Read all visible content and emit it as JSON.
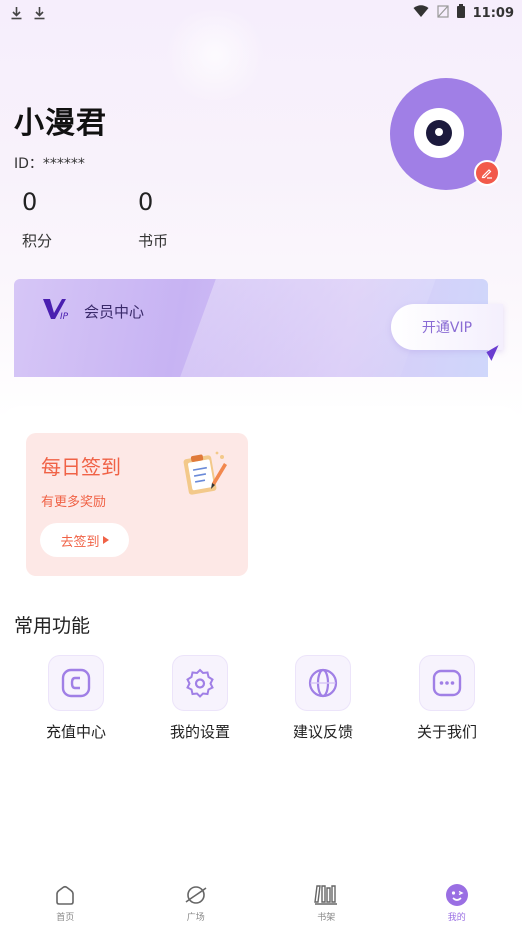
{
  "status_bar": {
    "time": "11:09"
  },
  "profile": {
    "username": "小漫君",
    "id_text": "ID：******",
    "stats": [
      {
        "value": "0",
        "label": "积分"
      },
      {
        "value": "0",
        "label": "书币"
      }
    ]
  },
  "vip": {
    "title": "会员中心",
    "button_label": "开通VIP",
    "colors": {
      "accent": "#8a6cd4",
      "card": "#c7b3f3"
    }
  },
  "checkin": {
    "title": "每日签到",
    "subtitle": "有更多奖励",
    "button_label": "去签到",
    "colors": {
      "text": "#f06246",
      "bg": "#fde8e6"
    }
  },
  "functions": {
    "section_title": "常用功能",
    "items": [
      {
        "label": "充值中心",
        "icon": "recharge-icon"
      },
      {
        "label": "我的设置",
        "icon": "settings-icon"
      },
      {
        "label": "建议反馈",
        "icon": "feedback-icon"
      },
      {
        "label": "关于我们",
        "icon": "about-icon"
      }
    ]
  },
  "tabbar": {
    "items": [
      {
        "label": "首页",
        "icon": "home-icon",
        "active": false
      },
      {
        "label": "广场",
        "icon": "planet-icon",
        "active": false
      },
      {
        "label": "书架",
        "icon": "bookshelf-icon",
        "active": false
      },
      {
        "label": "我的",
        "icon": "profile-face-icon",
        "active": true
      }
    ],
    "active_color": "#9a6fe3"
  }
}
